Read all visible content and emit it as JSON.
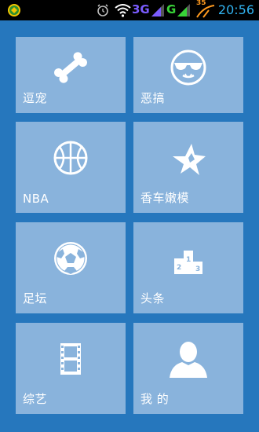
{
  "status_bar": {
    "time": "20:56",
    "network_3g": "3G",
    "network_g": "G",
    "notification_count": "35",
    "colors": {
      "time": "#31b3f0",
      "network_3g": "#7a5cff",
      "network_g": "#38d438",
      "badge": "#ff9a1f"
    },
    "icons": [
      "app-notification-icon",
      "alarm-icon",
      "wifi-icon",
      "signal-icon",
      "signal-icon",
      "upload-speed-icon"
    ]
  },
  "theme": {
    "background": "#2677bd",
    "tile": "#89b3dc",
    "text": "#ffffff"
  },
  "tiles": [
    {
      "label": "逗宠",
      "icon": "bone-icon"
    },
    {
      "label": "恶搞",
      "icon": "sunglasses-face-icon"
    },
    {
      "label": "NBA",
      "icon": "basketball-icon"
    },
    {
      "label": "香车嫩模",
      "icon": "star-car-logo-icon"
    },
    {
      "label": "足坛",
      "icon": "soccer-ball-icon"
    },
    {
      "label": "头条",
      "icon": "podium-icon"
    },
    {
      "label": "综艺",
      "icon": "film-strip-icon"
    },
    {
      "label": "我 的",
      "icon": "user-profile-icon"
    }
  ]
}
